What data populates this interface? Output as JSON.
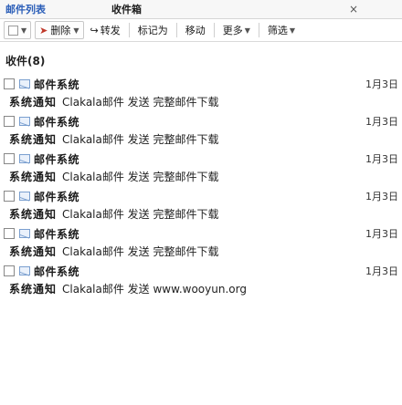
{
  "tabs": {
    "title": "邮件列表",
    "active": "收件箱",
    "close": "×"
  },
  "toolbar": {
    "delete": "删除",
    "reply": "转发",
    "forward": "转发",
    "mark": "标记为",
    "move": "移动",
    "more": "更多",
    "filter": "筛选"
  },
  "folder": {
    "label": "收件(8)"
  },
  "messages": [
    {
      "sender": "邮件系统",
      "date": "1月3日",
      "subject": "系统通知",
      "preview": "Clakala邮件 发送 完整邮件下载"
    },
    {
      "sender": "邮件系统",
      "date": "1月3日",
      "subject": "系统通知",
      "preview": "Clakala邮件 发送 完整邮件下载"
    },
    {
      "sender": "邮件系统",
      "date": "1月3日",
      "subject": "系统通知",
      "preview": "Clakala邮件 发送 完整邮件下载"
    },
    {
      "sender": "邮件系统",
      "date": "1月3日",
      "subject": "系统通知",
      "preview": "Clakala邮件 发送 完整邮件下载"
    },
    {
      "sender": "邮件系统",
      "date": "1月3日",
      "subject": "系统通知",
      "preview": "Clakala邮件 发送 完整邮件下载"
    },
    {
      "sender": "邮件系统",
      "date": "1月3日",
      "subject": "系统通知",
      "preview": "Clakala邮件 发送 www.wooyun.org"
    }
  ]
}
